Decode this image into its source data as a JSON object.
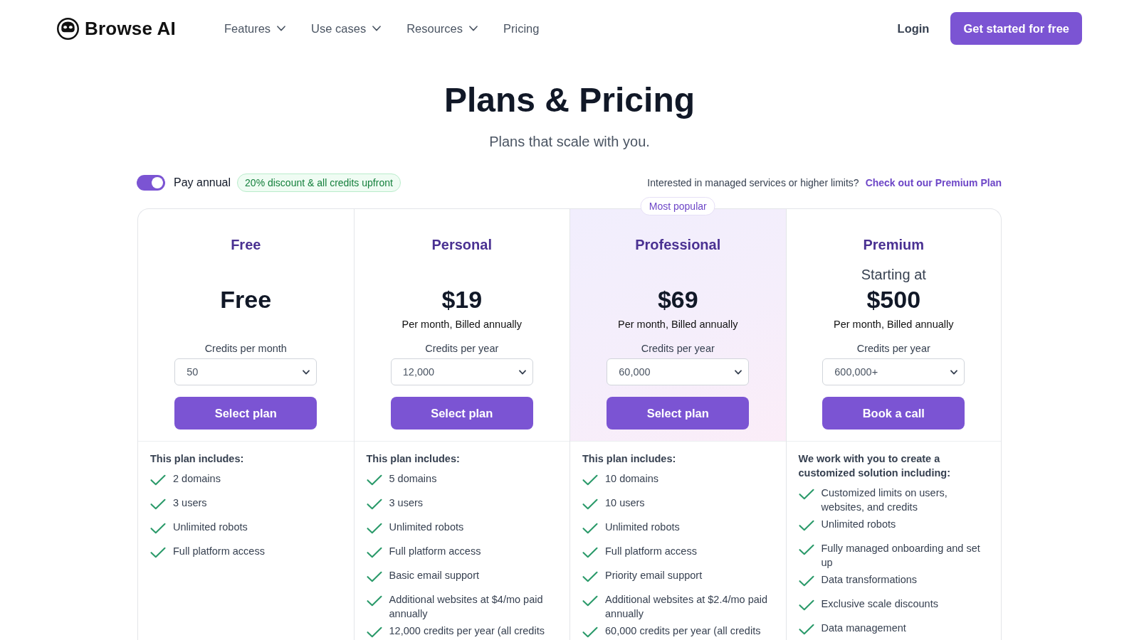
{
  "header": {
    "brand": "Browse AI",
    "nav": [
      {
        "label": "Features",
        "dropdown": true
      },
      {
        "label": "Use cases",
        "dropdown": true
      },
      {
        "label": "Resources",
        "dropdown": true
      },
      {
        "label": "Pricing",
        "dropdown": false
      }
    ],
    "login": "Login",
    "cta": "Get started for free"
  },
  "hero": {
    "title": "Plans & Pricing",
    "subtitle": "Plans that scale with you."
  },
  "billing": {
    "toggle": {
      "label": "Pay annual",
      "on": true
    },
    "discount_badge": "20% discount & all credits upfront",
    "note": "Interested in managed services or higher limits?",
    "link": "Check out our Premium Plan"
  },
  "plans": [
    {
      "name": "Free",
      "featured": false,
      "price": "Free",
      "credits_label": "Credits per month",
      "credits": "50",
      "button": "Select plan",
      "intro": "This plan includes:",
      "features": [
        "2 domains",
        "3 users",
        "Unlimited robots",
        "Full platform access"
      ]
    },
    {
      "name": "Personal",
      "featured": false,
      "price": "$19",
      "price_note": "Per month, Billed annually",
      "credits_label": "Credits per year",
      "credits": "12,000",
      "button": "Select plan",
      "intro": "This plan includes:",
      "features": [
        "5 domains",
        "3 users",
        "Unlimited robots",
        "Full platform access",
        "Basic email support",
        "Additional websites at $4/mo paid annually",
        "12,000 credits per year (all credits"
      ]
    },
    {
      "name": "Professional",
      "featured": true,
      "badge": "Most popular",
      "price": "$69",
      "price_note": "Per month, Billed annually",
      "credits_label": "Credits per year",
      "credits": "60,000",
      "button": "Select plan",
      "intro": "This plan includes:",
      "features": [
        "10 domains",
        "10 users",
        "Unlimited robots",
        "Full platform access",
        "Priority email support",
        "Additional websites at $2.4/mo paid annually",
        "60,000 credits per year (all credits"
      ]
    },
    {
      "name": "Premium",
      "featured": false,
      "price_prefix": "Starting at",
      "price": "$500",
      "price_note": "Per month, Billed annually",
      "credits_label": "Credits per year",
      "credits": "600,000+",
      "button": "Book a call",
      "intro": "We work with you to create a customized solution including:",
      "features": [
        "Customized limits on users, websites, and credits",
        "Unlimited robots",
        "Fully managed onboarding and set up",
        "Data transformations",
        "Exclusive scale discounts",
        "Data management"
      ]
    }
  ]
}
